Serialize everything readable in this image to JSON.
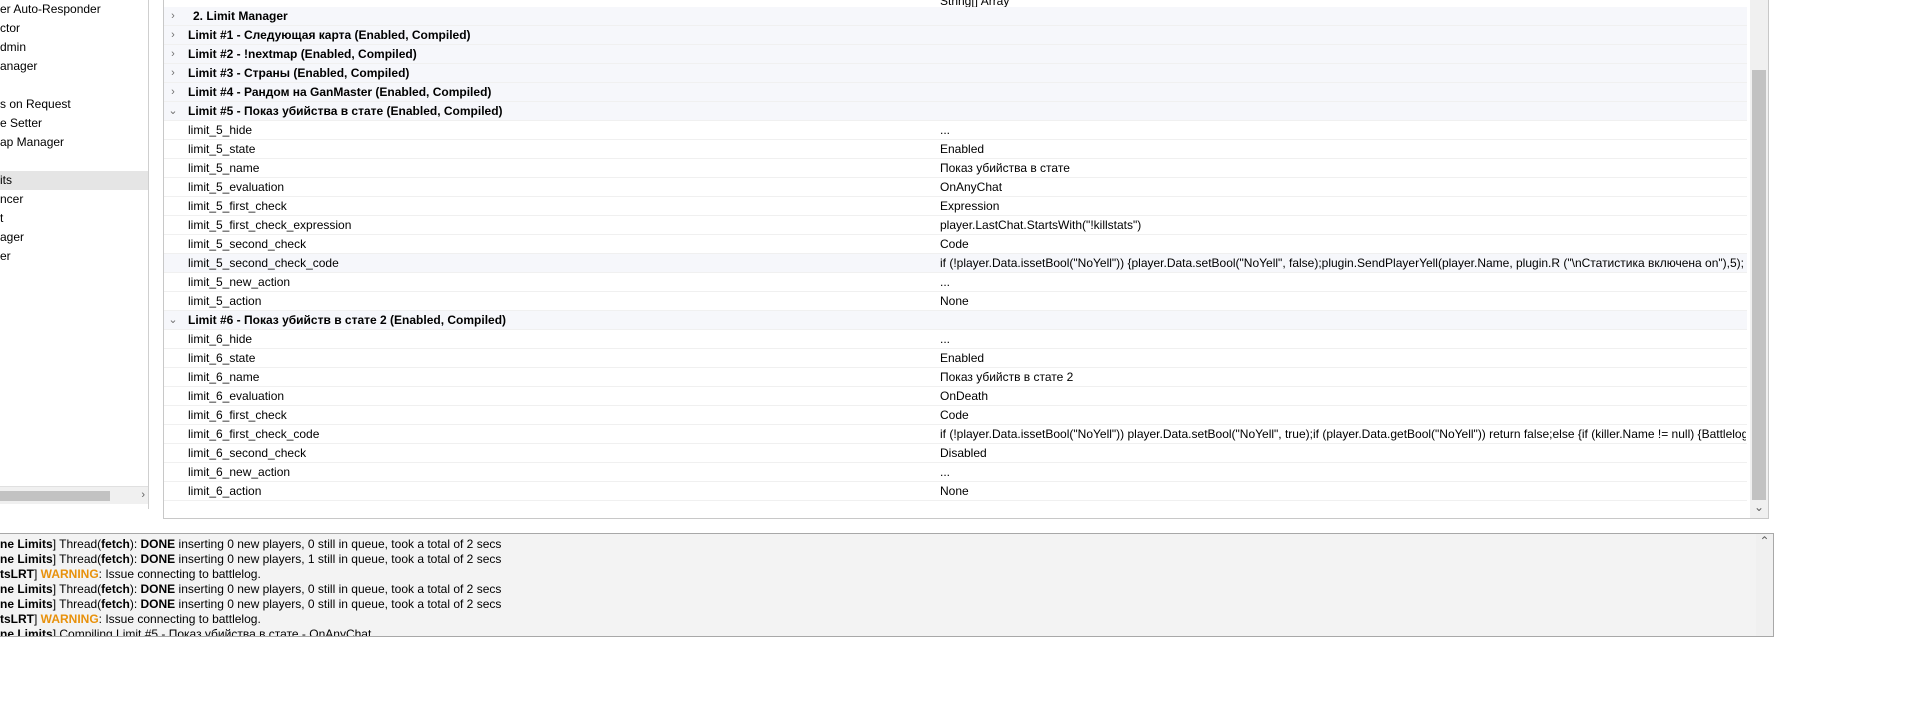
{
  "left_list": {
    "items": [
      {
        "label": "er Auto-Responder",
        "selected": false
      },
      {
        "label": "ctor",
        "selected": false
      },
      {
        "label": "dmin",
        "selected": false
      },
      {
        "label": "anager",
        "selected": false
      },
      {
        "label": "",
        "selected": false
      },
      {
        "label": "s on Request",
        "selected": false
      },
      {
        "label": "e Setter",
        "selected": false
      },
      {
        "label": "ap Manager",
        "selected": false
      },
      {
        "label": "",
        "selected": false
      },
      {
        "label": "its",
        "selected": true
      },
      {
        "label": "ncer",
        "selected": false
      },
      {
        "label": "t",
        "selected": false
      },
      {
        "label": "ager",
        "selected": false
      },
      {
        "label": "er",
        "selected": false
      }
    ],
    "scroll_right_glyph": "›"
  },
  "grid": {
    "top_partial": {
      "name": "",
      "value": "String[] Array"
    },
    "section_title": "2. Limit Manager",
    "collapsed_limits": [
      "Limit #1 - Следующая карта (Enabled, Compiled)",
      "Limit #2 - !nextmap (Enabled, Compiled)",
      "Limit #3 - Страны (Enabled, Compiled)",
      "Limit #4 - Рандом на GanMaster (Enabled, Compiled)"
    ],
    "limit5": {
      "title": "Limit #5 - Показ убийства в стате (Enabled, Compiled)",
      "props": [
        {
          "name": "limit_5_hide",
          "value": "..."
        },
        {
          "name": "limit_5_state",
          "value": "Enabled"
        },
        {
          "name": "limit_5_name",
          "value": "Показ убийства в стате"
        },
        {
          "name": "limit_5_evaluation",
          "value": "OnAnyChat"
        },
        {
          "name": "limit_5_first_check",
          "value": "Expression"
        },
        {
          "name": "limit_5_first_check_expression",
          "value": "player.LastChat.StartsWith(\"!killstats\")"
        },
        {
          "name": "limit_5_second_check",
          "value": "Code"
        },
        {
          "name": "limit_5_second_check_code",
          "value": "if (!player.Data.issetBool(\"NoYell\")) {player.Data.setBool(\"NoYell\", false);plugin.SendPlayerYell(player.Name, plugin.R (\"\\nСтатистика включена on\"),5);"
        },
        {
          "name": "limit_5_new_action",
          "value": "..."
        },
        {
          "name": "limit_5_action",
          "value": "None"
        }
      ]
    },
    "limit6": {
      "title": "Limit #6 - Показ убийств в стате 2 (Enabled, Compiled)",
      "props": [
        {
          "name": "limit_6_hide",
          "value": "..."
        },
        {
          "name": "limit_6_state",
          "value": "Enabled"
        },
        {
          "name": "limit_6_name",
          "value": "Показ убийств в стате 2"
        },
        {
          "name": "limit_6_evaluation",
          "value": "OnDeath"
        },
        {
          "name": "limit_6_first_check",
          "value": "Code"
        },
        {
          "name": "limit_6_first_check_code",
          "value": "if (!player.Data.issetBool(\"NoYell\")) player.Data.setBool(\"NoYell\", true);if (player.Data.getBool(\"NoYell\")) return false;else {if (killer.Name != null) {Battlelog"
        },
        {
          "name": "limit_6_second_check",
          "value": "Disabled"
        },
        {
          "name": "limit_6_new_action",
          "value": "..."
        },
        {
          "name": "limit_6_action",
          "value": "None"
        }
      ]
    },
    "twisty_collapsed": "›",
    "twisty_expanded": "⌄",
    "scroll_down_glyph": "⌄"
  },
  "log": {
    "scroll_up_glyph": "⌃",
    "lines": [
      {
        "prefix": "ne Limits",
        "thread": "Thread(",
        "thread_name": "fetch",
        "thread_close": "): ",
        "status": "DONE",
        "rest": " inserting 0 new players, 0 still in queue, took a total of 2 secs"
      },
      {
        "prefix": "ne Limits",
        "thread": "Thread(",
        "thread_name": "fetch",
        "thread_close": "): ",
        "status": "DONE",
        "rest": " inserting 0 new players, 1 still in queue, took a total of 2 secs"
      },
      {
        "prefix": "tsLRT",
        "warning": "WARNING",
        "rest": ": Issue connecting to battlelog."
      },
      {
        "prefix": "ne Limits",
        "thread": "Thread(",
        "thread_name": "fetch",
        "thread_close": "): ",
        "status": "DONE",
        "rest": " inserting 0 new players, 0 still in queue, took a total of 2 secs"
      },
      {
        "prefix": "ne Limits",
        "thread": "Thread(",
        "thread_name": "fetch",
        "thread_close": "): ",
        "status": "DONE",
        "rest": " inserting 0 new players, 0 still in queue, took a total of 2 secs"
      },
      {
        "prefix": "tsLRT",
        "warning": "WARNING",
        "rest": ": Issue connecting to battlelog."
      },
      {
        "prefix": "ne Limits",
        "rest": " Compiling Limit #5 - Показ убийства в стате - OnAnyChat"
      }
    ]
  }
}
